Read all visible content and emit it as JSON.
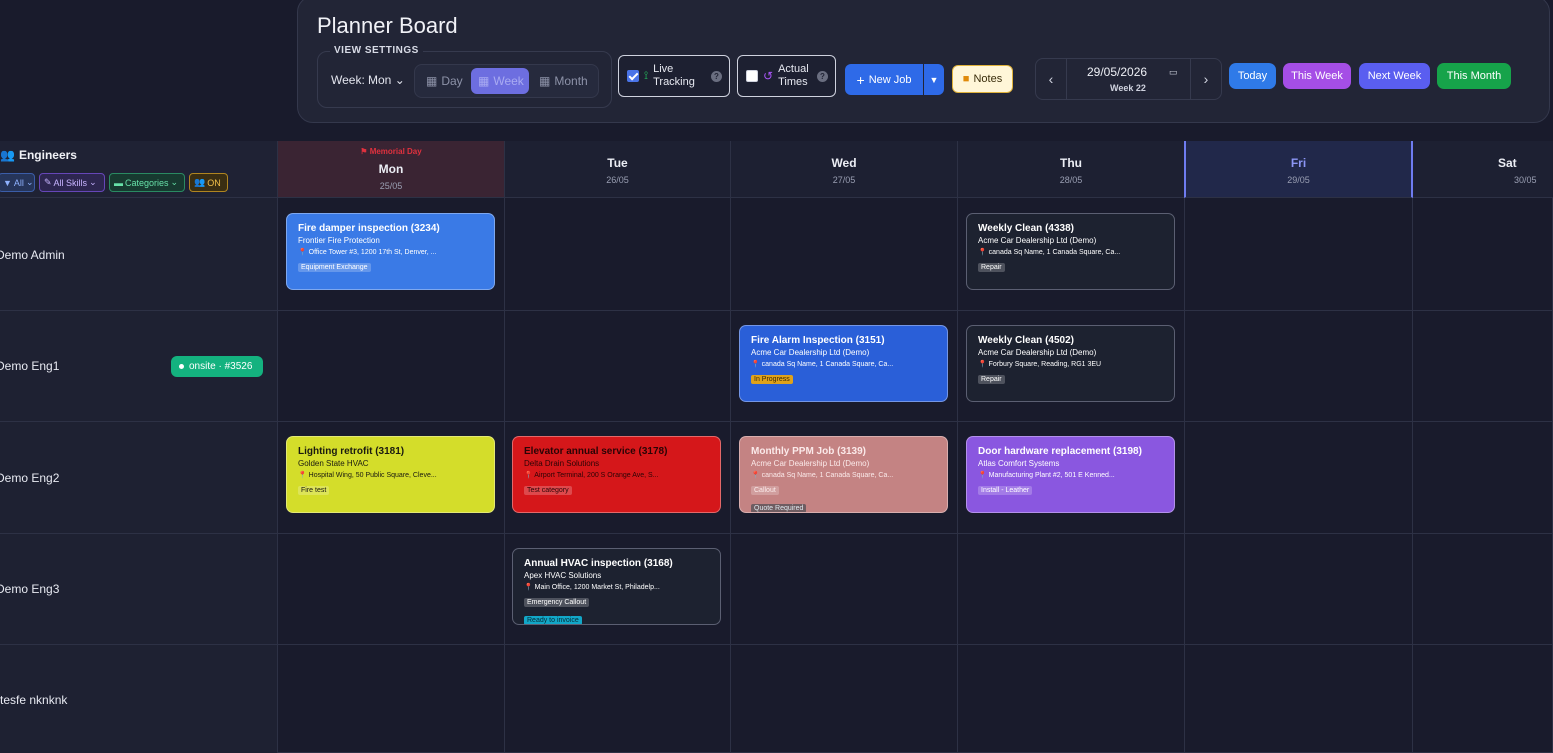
{
  "header": {
    "title": "Planner Board",
    "view_settings_label": "VIEW SETTINGS",
    "week_label": "Week:",
    "week_start": "Mon",
    "view_modes": [
      "Day",
      "Week",
      "Month"
    ],
    "active_view": "Week",
    "live_tracking": "Live Tracking",
    "actual_times": "Actual Times",
    "new_job": "New Job",
    "notes": "Notes",
    "date": "29/05/2026",
    "week_number": "Week 22",
    "today": "Today",
    "this_week": "This Week",
    "next_week": "Next Week",
    "this_month": "This Month"
  },
  "engineers": {
    "title": "Engineers",
    "filters": {
      "all": "All",
      "skills": "All Skills",
      "categories": "Categories",
      "on": "ON"
    }
  },
  "days": [
    {
      "name": "Mon",
      "date": "25/05",
      "holiday": "Memorial Day"
    },
    {
      "name": "Tue",
      "date": "26/05"
    },
    {
      "name": "Wed",
      "date": "27/05"
    },
    {
      "name": "Thu",
      "date": "28/05"
    },
    {
      "name": "Fri",
      "date": "29/05"
    },
    {
      "name": "Sat",
      "date": "30/05"
    }
  ],
  "rows": [
    {
      "name": "Demo Admin"
    },
    {
      "name": "Demo Eng1",
      "status": "onsite · #3526"
    },
    {
      "name": "Demo Eng2"
    },
    {
      "name": "Demo Eng3"
    },
    {
      "name": "rtesfe nknknk"
    }
  ],
  "jobs": [
    {
      "title": "Fire damper inspection (3234)",
      "client": "Frontier Fire Protection",
      "address": "📍 Office Tower #3, 1200 17th St, Denver, ...",
      "tag": "Equipment Exchange",
      "bg": "#3a7ae6",
      "text": "#ffffff"
    },
    {
      "title": "Weekly Clean (4338)",
      "client": "Acme Car Dealership Ltd (Demo)",
      "address": "📍 canada Sq Name, 1 Canada Square, Ca...",
      "tag": "Repair",
      "bg": "#1d2230",
      "text": "#ffffff"
    },
    {
      "title": "Fire Alarm Inspection (3151)",
      "client": "Acme Car Dealership Ltd (Demo)",
      "address": "📍 canada Sq Name, 1 Canada Square, Ca...",
      "tag": "In Progress",
      "bg": "#2a5fd8",
      "text": "#ffffff"
    },
    {
      "title": "Weekly Clean (4502)",
      "client": "Acme Car Dealership Ltd (Demo)",
      "address": "📍 Forbury Square, Reading, RG1 3EU",
      "tag": "Repair",
      "bg": "#1d2230",
      "text": "#ffffff"
    },
    {
      "title": "Lighting retrofit (3181)",
      "client": "Golden State HVAC",
      "address": "📍 Hospital Wing, 50 Public Square, Cleve...",
      "tag": "Fire test",
      "bg": "#d4dd2a",
      "text": "#1a1a10"
    },
    {
      "title": "Elevator annual service (3178)",
      "client": "Delta Drain Solutions",
      "address": "📍 Airport Terminal, 200 S Orange Ave, S...",
      "tag": "Test category",
      "bg": "#d5171a",
      "text": "#2a0406"
    },
    {
      "title": "Monthly PPM Job (3139)",
      "client": "Acme Car Dealership Ltd (Demo)",
      "address": "📍 canada Sq Name, 1 Canada Square, Ca...",
      "tag": "Callout",
      "tag2": "Quote Required",
      "bg": "#c48383",
      "text": "#fbeaea"
    },
    {
      "title": "Door hardware replacement (3198)",
      "client": "Atlas Comfort Systems",
      "address": "📍 Manufacturing Plant #2, 501 E Kenned...",
      "tag": "Install - Leather",
      "bg": "#8a57e0",
      "text": "#ffffff"
    },
    {
      "title": "Annual HVAC inspection (3168)",
      "client": "Apex HVAC Solutions",
      "address": "📍 Main Office, 1200 Market St, Philadelp...",
      "tag": "Emergency Callout",
      "tag2": "Ready to invoice",
      "bg": "#1d2230",
      "text": "#ffffff"
    }
  ],
  "colors": {
    "accent": "#6d6ee0",
    "today_btn": "#2f7ae8",
    "this_week_btn": "#a54ee6",
    "next_week_btn": "#5a5ef0",
    "this_month_btn": "#16a34a",
    "onsite": "#14b27f"
  }
}
